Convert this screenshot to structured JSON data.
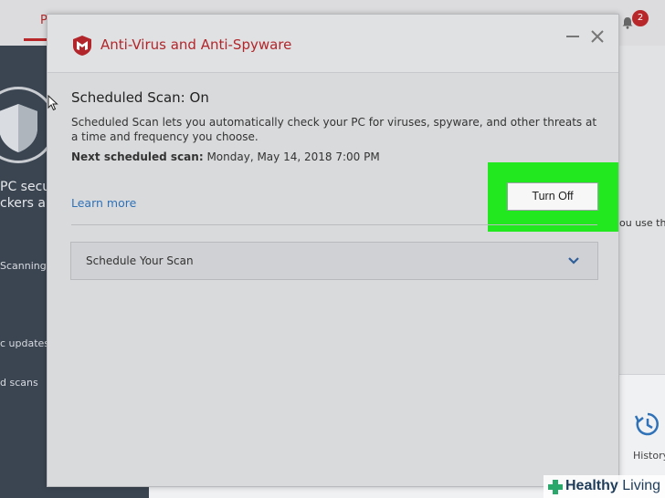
{
  "background": {
    "tab_fragment": "P",
    "notification_count": "2",
    "sidebar": {
      "hero_line1": "PC secu",
      "hero_line2": "ckers and",
      "items": [
        "Scanning",
        "c updates",
        "d scans"
      ]
    },
    "content": {
      "right_text_fragment": "ou use th",
      "history_label": "History"
    }
  },
  "modal": {
    "title": "Anti-Virus and Anti-Spyware",
    "heading": "Scheduled Scan: On",
    "description": "Scheduled Scan lets you automatically check your PC for viruses, spyware, and other threats at a time and frequency you choose.",
    "next_scan_label": "Next scheduled scan:",
    "next_scan_value": "Monday, May 14, 2018 7:00 PM",
    "learn_more": "Learn more",
    "turn_off_button": "Turn Off",
    "accordion_label": "Schedule Your Scan"
  },
  "watermark": {
    "brand_bold": "Healthy",
    "brand_thin": "Living"
  },
  "colors": {
    "brand_red": "#b2262b",
    "highlight_green": "#22e81f",
    "link_blue": "#2f72b8",
    "sidebar_bg": "#3b4552"
  }
}
